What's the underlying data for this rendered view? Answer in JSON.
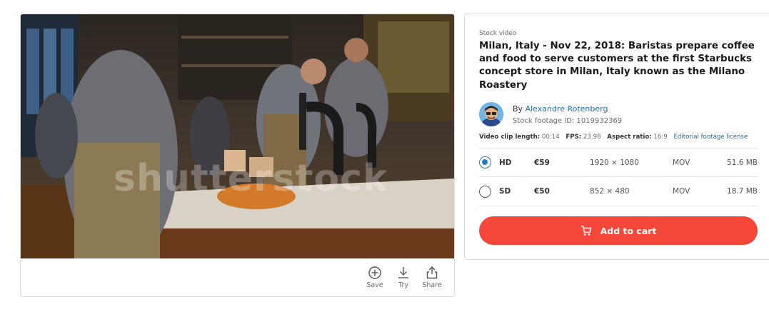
{
  "preview": {
    "watermark": "shutterstock"
  },
  "actions": [
    {
      "label": "Save",
      "icon": "plus-circle-icon"
    },
    {
      "label": "Try",
      "icon": "download-icon"
    },
    {
      "label": "Share",
      "icon": "share-icon"
    }
  ],
  "info": {
    "eyebrow": "Stock video",
    "title": "Milan, Italy - Nov 22, 2018: Baristas prepare coffee and food to serve customers at the first Starbucks concept store in Milan, Italy known as the Milano Roastery",
    "by_prefix": "By",
    "author": "Alexandre Rotenberg",
    "footage_id": "Stock footage ID: 1019932369",
    "meta": {
      "clip_length_label": "Video clip length:",
      "clip_length": "00:14",
      "fps_label": "FPS:",
      "fps": "23.98",
      "aspect_label": "Aspect ratio:",
      "aspect": "16:9",
      "license_link": "Editorial footage license"
    }
  },
  "options": [
    {
      "quality": "HD",
      "price": "€59",
      "resolution": "1920 × 1080",
      "format": "MOV",
      "size": "51.6 MB",
      "selected": true
    },
    {
      "quality": "SD",
      "price": "€50",
      "resolution": "852 × 480",
      "format": "MOV",
      "size": "18.7 MB",
      "selected": false
    }
  ],
  "cart": {
    "label": "Add to cart",
    "icon": "cart-icon",
    "color": "#f4473a"
  },
  "colors": {
    "link": "#1f6fb5",
    "radio_selected": "#1f7fc0"
  }
}
